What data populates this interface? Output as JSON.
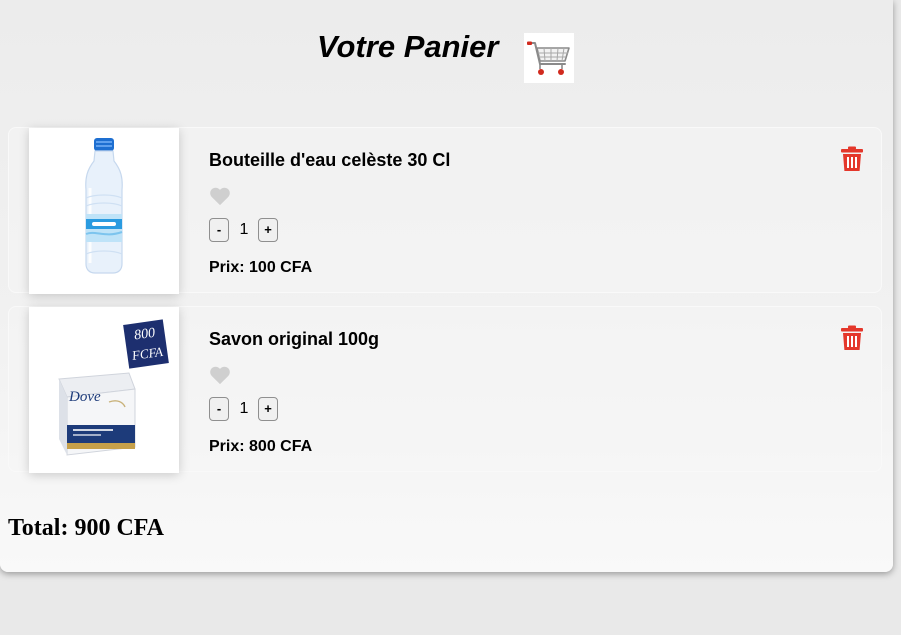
{
  "header": {
    "title": "Votre Panier",
    "cart_icon": "shopping-cart-icon"
  },
  "cart": {
    "items": [
      {
        "name": "Bouteille d'eau celèste 30 Cl",
        "image": "water-bottle-image",
        "quantity": "1",
        "price": "Prix: 100 CFA",
        "minus_label": "-",
        "plus_label": "+"
      },
      {
        "name": "Savon original 100g",
        "image": "dove-soap-image",
        "image_text": {
          "tag_line1": "800",
          "tag_line2": "FCFA",
          "brand": "Dove"
        },
        "quantity": "1",
        "price": "Prix: 800 CFA",
        "minus_label": "-",
        "plus_label": "+"
      }
    ],
    "total": "Total: 900 CFA"
  },
  "colors": {
    "trash": "#e4372b",
    "heart": "#cfcfcf",
    "panel_background": "#f1f1f1"
  },
  "icons": {
    "favorite": "heart-icon",
    "remove": "trash-icon"
  }
}
